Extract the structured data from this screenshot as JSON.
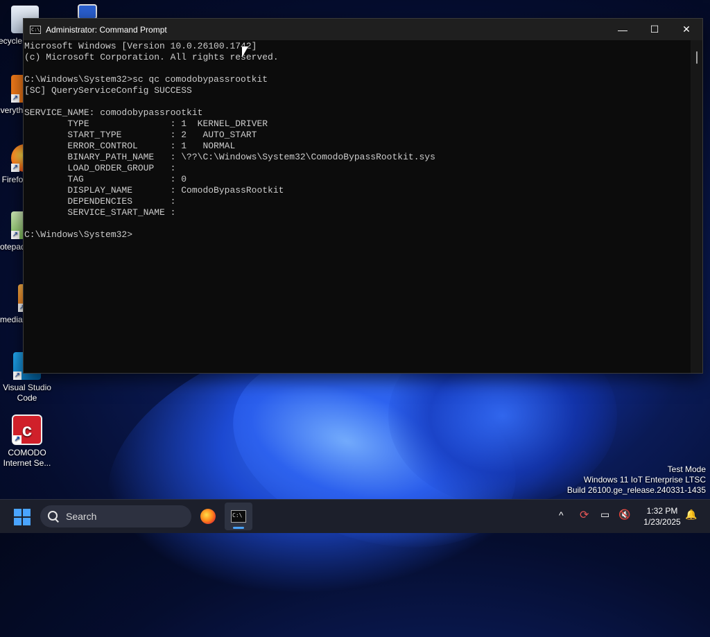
{
  "desktop": {
    "icons": [
      {
        "label": "Recycle Bin"
      },
      {
        "label": "This PC"
      },
      {
        "label": "Everything"
      },
      {
        "label": "Firefox"
      },
      {
        "label": "Notepad++"
      },
      {
        "label": "VLC media player"
      },
      {
        "label": "Visual Studio Code"
      },
      {
        "label": "COMODO Internet Se..."
      }
    ]
  },
  "window": {
    "title": "Administrator: Command Prompt",
    "minimize": "—",
    "maximize": "☐",
    "close": "✕",
    "console_lines": [
      "Microsoft Windows [Version 10.0.26100.1742]",
      "(c) Microsoft Corporation. All rights reserved.",
      "",
      "C:\\Windows\\System32>sc qc comodobypassrootkit",
      "[SC] QueryServiceConfig SUCCESS",
      "",
      "SERVICE_NAME: comodobypassrootkit",
      "        TYPE               : 1  KERNEL_DRIVER",
      "        START_TYPE         : 2   AUTO_START",
      "        ERROR_CONTROL      : 1   NORMAL",
      "        BINARY_PATH_NAME   : \\??\\C:\\Windows\\System32\\ComodoBypassRootkit.sys",
      "        LOAD_ORDER_GROUP   :",
      "        TAG                : 0",
      "        DISPLAY_NAME       : ComodoBypassRootkit",
      "        DEPENDENCIES       :",
      "        SERVICE_START_NAME :",
      "",
      "C:\\Windows\\System32>"
    ]
  },
  "watermark": {
    "line1": "Test Mode",
    "line2": "Windows 11 IoT Enterprise LTSC",
    "line3": "Build 26100.ge_release.240331-1435"
  },
  "taskbar": {
    "search_placeholder": "Search",
    "chevron": "^",
    "time": "1:32 PM",
    "date": "1/23/2025"
  },
  "colors": {
    "console_bg": "#0c0c0c",
    "console_text": "#cccccc",
    "taskbar_bg": "#1c1f2b",
    "accent": "#4aa4ff"
  }
}
